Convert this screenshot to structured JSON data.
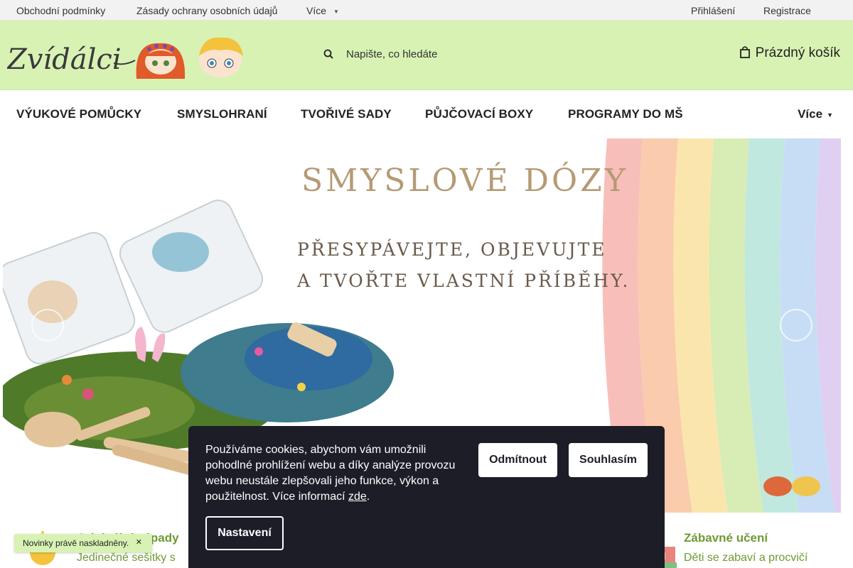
{
  "topbar": {
    "links": [
      "Obchodní podmínky",
      "Zásady ochrany osobních údajů",
      "Více"
    ],
    "login": "Přihlášení",
    "register": "Registrace"
  },
  "header": {
    "logo_text": "Zvídálci",
    "search_placeholder": "Napište, co hledáte",
    "cart_label": "Prázdný košík"
  },
  "nav": {
    "items": [
      "VÝUKOVÉ POMŮCKY",
      "SMYSLOHRANÍ",
      "TVOŘIVÉ SADY",
      "PŮJČOVACÍ BOXY",
      "PROGRAMY DO MŠ"
    ],
    "more": "Více"
  },
  "banner": {
    "title": "SMYSLOVÉ DÓZY",
    "subtitle_line1": "PŘESYPÁVEJTE, OBJEVUJTE",
    "subtitle_line2": "A TVOŘTE VLASTNÍ PŘÍBĚHY."
  },
  "benefits": [
    {
      "title": "Originální nápady",
      "text": "Jedinečné sešitky s"
    },
    {
      "title": "Zábavné učení",
      "text": "Děti se zabaví a procvičí"
    }
  ],
  "toast": {
    "text": "Novinky právě naskladněny."
  },
  "cookie": {
    "message": "Používáme cookies, abychom vám umožnili pohodlné prohlížení webu a díky analýze provozu webu neustále zlepšovali jeho funkce, výkon a použitelnost. Více informací",
    "link": "zde",
    "decline": "Odmítnout",
    "accept": "Souhlasím",
    "settings": "Nastavení"
  },
  "colors": {
    "header_bg": "#d8f2b4",
    "accent_green": "#6e9a32",
    "cookie_bg": "#1d1d28"
  }
}
